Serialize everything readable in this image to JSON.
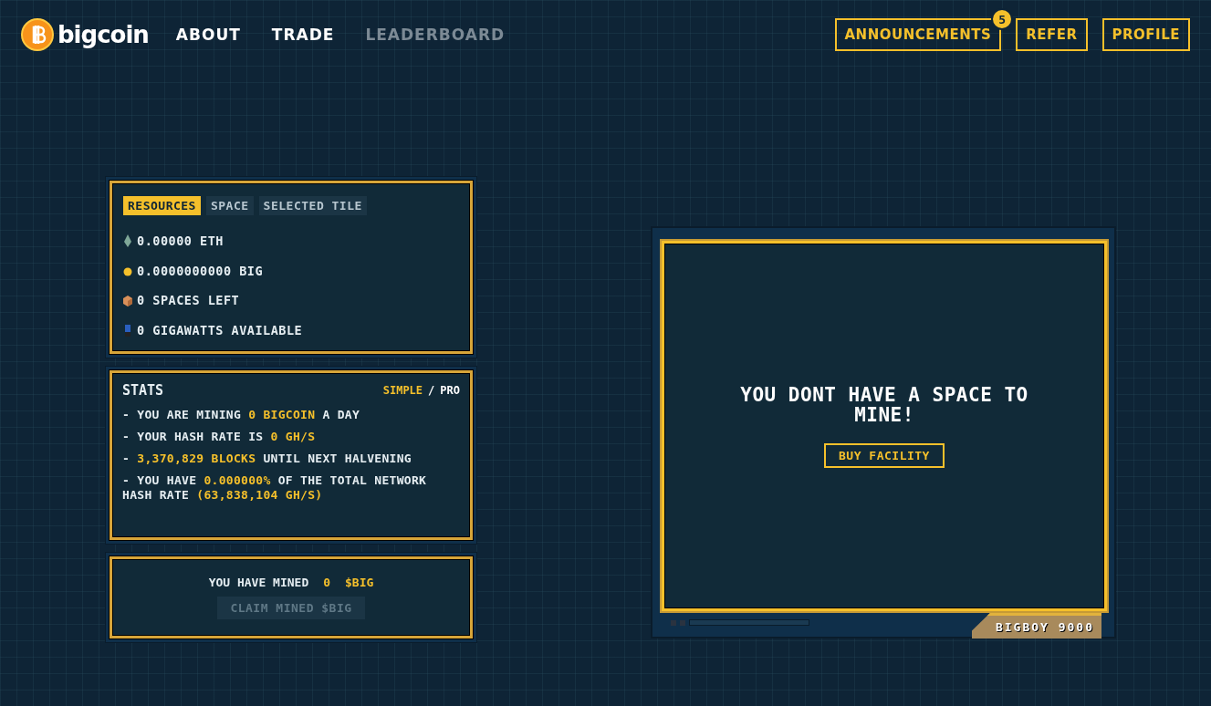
{
  "header": {
    "logo": "bigcoin",
    "nav": [
      {
        "label": "ABOUT",
        "disabled": false
      },
      {
        "label": "TRADE",
        "disabled": false
      },
      {
        "label": "LEADERBOARD",
        "disabled": true
      }
    ],
    "actions": [
      {
        "label": "ANNOUNCEMENTS",
        "badge": "5"
      },
      {
        "label": "REFER"
      },
      {
        "label": "PROFILE"
      }
    ]
  },
  "resources": {
    "tabs": [
      {
        "label": "RESOURCES",
        "selected": true
      },
      {
        "label": "SPACE",
        "selected": false
      },
      {
        "label": "SELECTED TILE",
        "selected": false
      }
    ],
    "items": [
      {
        "kind": "eth",
        "text": "0.00000 ETH"
      },
      {
        "kind": "coin",
        "text": "0.0000000000 BIG"
      },
      {
        "kind": "box",
        "text": "0 SPACES LEFT"
      },
      {
        "kind": "power",
        "text": "0 GIGAWATTS AVAILABLE"
      }
    ]
  },
  "stats": {
    "title": "STATS",
    "modes": [
      {
        "label": "SIMPLE",
        "selected": true
      },
      {
        "label": "PRO",
        "selected": false
      }
    ],
    "separator": "/",
    "lines": [
      "- YOU ARE MINING **0 BIGCOIN** A DAY",
      "- YOUR HASH RATE IS **0 GH/S**",
      "- **3,370,829 BLOCKS** UNTIL NEXT HALVENING",
      "- YOU HAVE **0.000000%** OF THE TOTAL NETWORK HASH RATE **(63,838,104 GH/S)**"
    ]
  },
  "mined": {
    "label": "YOU HAVE MINED",
    "amount": "0",
    "unit": "$BIG",
    "claim": {
      "label": "CLAIM MINED $BIG",
      "disabled": true
    }
  },
  "miner": {
    "message": "YOU DONT HAVE A SPACE TO MINE!",
    "button": "BUY FACILITY",
    "plate": "BIGBOY 9000"
  }
}
